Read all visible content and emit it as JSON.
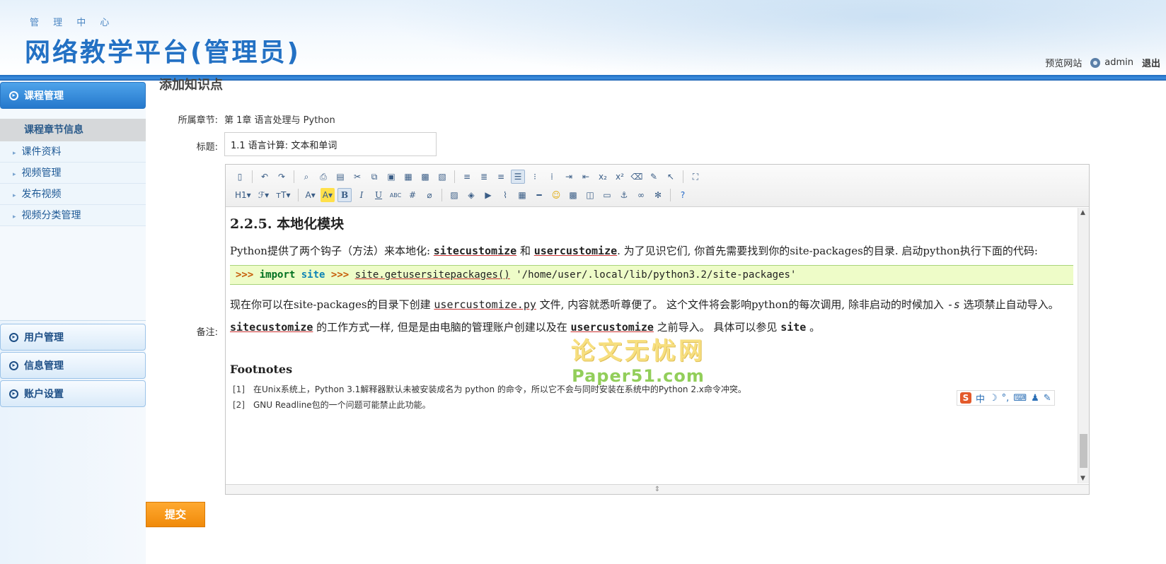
{
  "header": {
    "subtitle": "管 理 中 心",
    "title": "网络教学平台(管理员)",
    "preview_link": "预览网站",
    "user": "admin",
    "logout": "退出"
  },
  "sidebar": {
    "course_mgmt": "课程管理",
    "section_title": "课程章节信息",
    "items": [
      {
        "label": "课件资料"
      },
      {
        "label": "视频管理"
      },
      {
        "label": "发布视频"
      },
      {
        "label": "视频分类管理"
      }
    ],
    "user_mgmt": "用户管理",
    "info_mgmt": "信息管理",
    "account_settings": "账户设置"
  },
  "main": {
    "page_title": "添加知识点",
    "chapter_label": "所属章节:",
    "chapter_value": "第 1章 语言处理与 Python",
    "title_label": "标题:",
    "title_value": "1.1 语言计算: 文本和单词",
    "remark_label": "备注:",
    "submit": "提交"
  },
  "toolbar": {
    "heading_btn": "H1",
    "font_btn": "ℱ",
    "size_btn": "тT",
    "font_color_btn": "A",
    "bg_color_btn": "A",
    "bold_btn": "B",
    "italic_btn": "I",
    "underline_btn": "U",
    "strike_btn": "ABC"
  },
  "editor": {
    "heading": "2.2.5. 本地化模块",
    "p1_a": "Python提供了两个钩子（方法）来本地化: ",
    "p1_site": "sitecustomize",
    "p1_and": " 和 ",
    "p1_user": "usercustomize",
    "p1_b": ". 为了见识它们, 你首先需要找到你的site-packages的目录. 启动python执行下面的代码:",
    "code_prompt1": ">>>",
    "code_import": "import",
    "code_site": "site",
    "code_prompt2": ">>>",
    "code_call": "site.getusersitepackages()",
    "code_result": " '/home/user/.local/lib/python3.2/site-packages'",
    "p2_a": "现在你可以在site-packages的目录下创建 ",
    "p2_file": "usercustomize.py",
    "p2_b": " 文件, 内容就悉听尊便了。 这个文件将会影响python的每次调用, 除非启动的时候加入 ",
    "p2_flag": "-s",
    "p2_c": " 选项禁止自动导入。",
    "p3_site": "sitecustomize",
    "p3_a": " 的工作方式一样, 但是是由电脑的管理账户创建以及在 ",
    "p3_user": "usercustomize",
    "p3_b": " 之前导入。 具体可以参见 ",
    "p3_link": "site",
    "p3_c": " 。",
    "footnotes_title": "Footnotes",
    "fn1_ref": "[1]",
    "fn1": "在Unix系统上，Python 3.1解释器默认未被安装成名为 python 的命令，所以它不会与同时安装在系统中的Python 2.x命令冲突。",
    "fn2_ref": "[2]",
    "fn2": "GNU Readline包的一个问题可能禁止此功能。"
  },
  "ime": {
    "logo": "S",
    "lang": "中",
    "moon": "☽",
    "dot": "°,",
    "kbd": "⌨",
    "shirt": "♟",
    "tool": "✎"
  },
  "watermark": {
    "line1": "论文无忧网",
    "line2": "Paper51.com"
  },
  "colors": {
    "brand": "#2371c4",
    "header_bar": "#1f6cbf",
    "submit": "#f08a0a",
    "code_bg": "#eefcc8"
  }
}
